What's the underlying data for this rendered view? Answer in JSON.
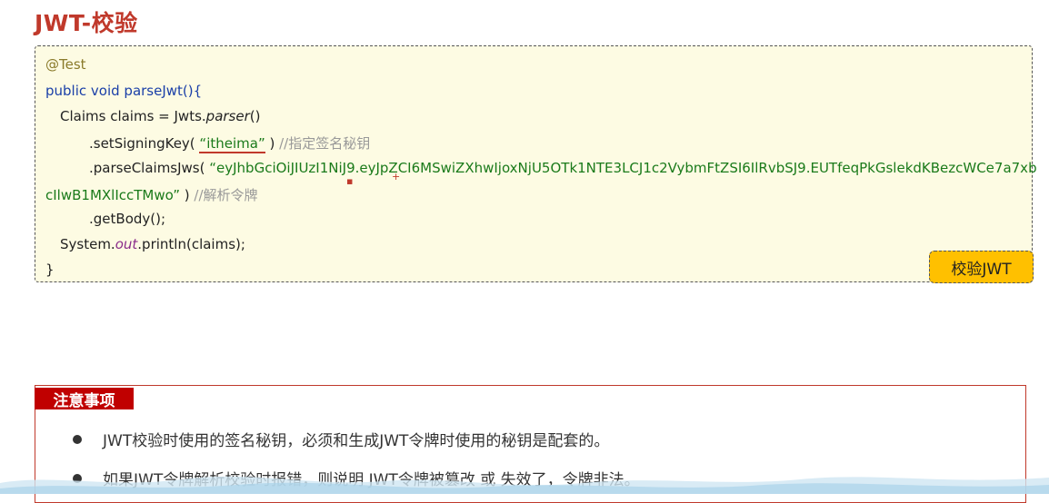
{
  "page": {
    "title": "JWT-校验"
  },
  "code": {
    "line1": "@Test",
    "line2_kw": "public void ",
    "line2_rest": "parseJwt(){",
    "line3_a": "Claims claims = Jwts.",
    "line3_b": "parser",
    "line3_c": "()",
    "line4_a": ".setSigningKey( ",
    "line4_str": "“itheima”",
    "line4_b": " ) ",
    "line4_cmt": "//指定签名秘钥",
    "line5_a": ".parseClaimsJws( ",
    "line5_str": "“eyJhbGciOiJIUzI1NiJ9.eyJpZCI6MSwiZXhwIjoxNjU5OTk1NTE3LCJ1c2VybmFtZSI6IlRvbSJ9.EUTfeqPkGslekdKBezcWCe7a7xb",
    "line6_str": "cIlwB1MXlIccTMwo”",
    "line6_b": " ) ",
    "line6_cmt": "//解析令牌",
    "line7": ".getBody();",
    "line8_a": "System.",
    "line8_b": "out",
    "line8_c": ".println(claims);",
    "line9": "}"
  },
  "verify_button": {
    "label": "校验JWT"
  },
  "notes": {
    "label": "注意事项",
    "items": [
      "JWT校验时使用的签名秘钥，必须和生成JWT令牌时使用的秘钥是配套的。",
      "如果JWT令牌解析校验时报错，则说明 JWT令牌被篡改 或 失效了，令牌非法。"
    ]
  },
  "colors": {
    "title": "#c0392b",
    "code_bg": "#fdfbe3",
    "button_bg": "#ffc000",
    "note_label_bg": "#c00000"
  }
}
